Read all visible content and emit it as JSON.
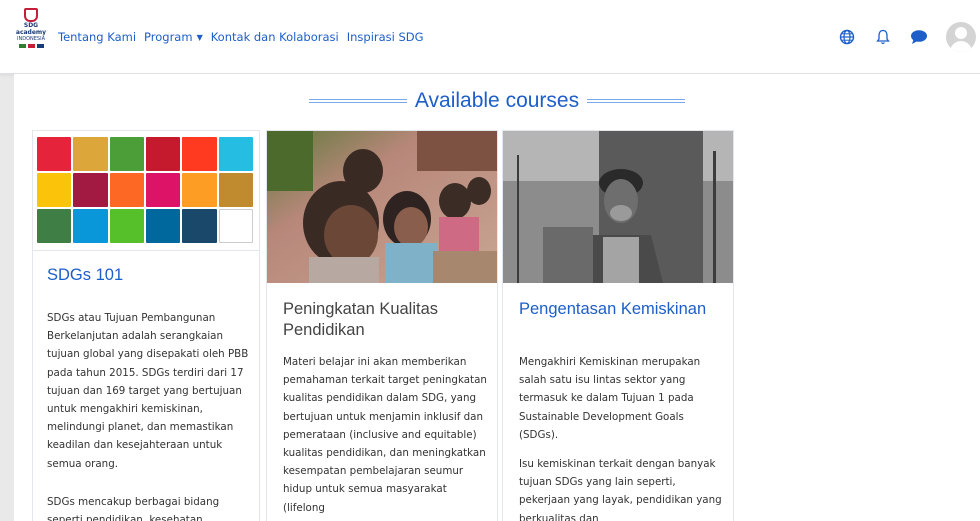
{
  "nav": {
    "logo_line1": "SDG",
    "logo_line2": "academy",
    "logo_line3": "INDONESIA",
    "links": [
      "Tentang Kami",
      "Program",
      "Kontak dan Kolaborasi",
      "Inspirasi SDG"
    ],
    "program_caret": "▼"
  },
  "header_icons": [
    "globe-icon",
    "bell-icon",
    "chat-icon",
    "user-avatar"
  ],
  "page": {
    "heading": "Available courses"
  },
  "colors": {
    "accent": "#1d5ec9",
    "sdg": [
      "#e5243b",
      "#dda63a",
      "#4c9f38",
      "#c5192d",
      "#ff3a21",
      "#26bde2",
      "#fcc30b",
      "#a21942",
      "#fd6925",
      "#dd1367",
      "#fd9d24",
      "#bf8b2e",
      "#3f7e44",
      "#0a97d9",
      "#56c02b",
      "#00689d",
      "#19486a",
      "#ffffff"
    ]
  },
  "courses": [
    {
      "title": "SDGs 101",
      "description": "SDGs atau Tujuan Pembangunan Berkelanjutan adalah serangkaian tujuan global yang disepakati oleh PBB pada tahun 2015. SDGs terdiri dari 17 tujuan dan 169 target yang bertujuan untuk mengakhiri kemiskinan, melindungi planet, dan memastikan keadilan dan kesejahteraan untuk semua orang.",
      "description2": "SDGs mencakup berbagai bidang seperti pendidikan, kesehatan"
    },
    {
      "title": "Peningkatan Kualitas Pendidikan",
      "description": "Materi belajar ini akan memberikan pemahaman terkait target peningkatan kualitas pendidikan dalam SDG, yang bertujuan untuk menjamin inklusif dan pemerataan (inclusive and equitable) kualitas pendidikan, dan meningkatkan kesempatan pembelajaran seumur hidup untuk semua masyarakat (lifelong"
    },
    {
      "title": "Pengentasan Kemiskinan",
      "description": "Mengakhiri Kemiskinan merupakan salah satu isu lintas sektor yang termasuk ke dalam Tujuan 1 pada Sustainable Development Goals (SDGs).",
      "description2": "Isu kemiskinan terkait dengan banyak tujuan SDGs yang lain seperti, pekerjaan yang layak, pendidikan yang berkualitas dan"
    }
  ]
}
